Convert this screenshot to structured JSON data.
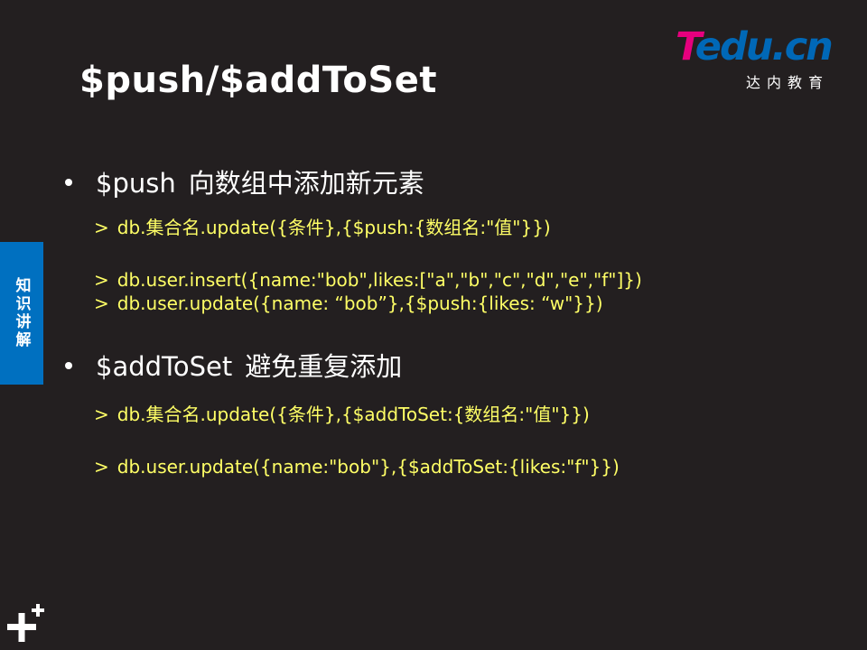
{
  "slide": {
    "title": "$push/$addToSet",
    "logo": {
      "brand_t": "T",
      "brand_rest": "edu.cn",
      "subtitle": "达内教育"
    },
    "side_tab": "知识讲解",
    "sections": [
      {
        "keyword": "$push",
        "description": "向数组中添加新元素",
        "lines": [
          "db.集合名.update({条件},{$push:{数组名:\"值\"}})",
          "db.user.insert({name:\"bob\",likes:[\"a\",\"b\",\"c\",\"d\",\"e\",\"f\"]})",
          "db.user.update({name: “bob”},{$push:{likes: “w\"}})"
        ]
      },
      {
        "keyword": "$addToSet",
        "description": "避免重复添加",
        "lines": [
          "db.集合名.update({条件},{$addToSet:{数组名:\"值\"}})",
          "db.user.update({name:\"bob\"},{$addToSet:{likes:\"f\"}})"
        ]
      }
    ],
    "prompt_symbol": ">",
    "colors": {
      "background": "#231f20",
      "code": "#ffff66",
      "tab": "#0070c0",
      "brand_pink": "#e6007e",
      "brand_blue": "#0068b7"
    },
    "icons": {
      "corner": "plus-icon"
    }
  }
}
